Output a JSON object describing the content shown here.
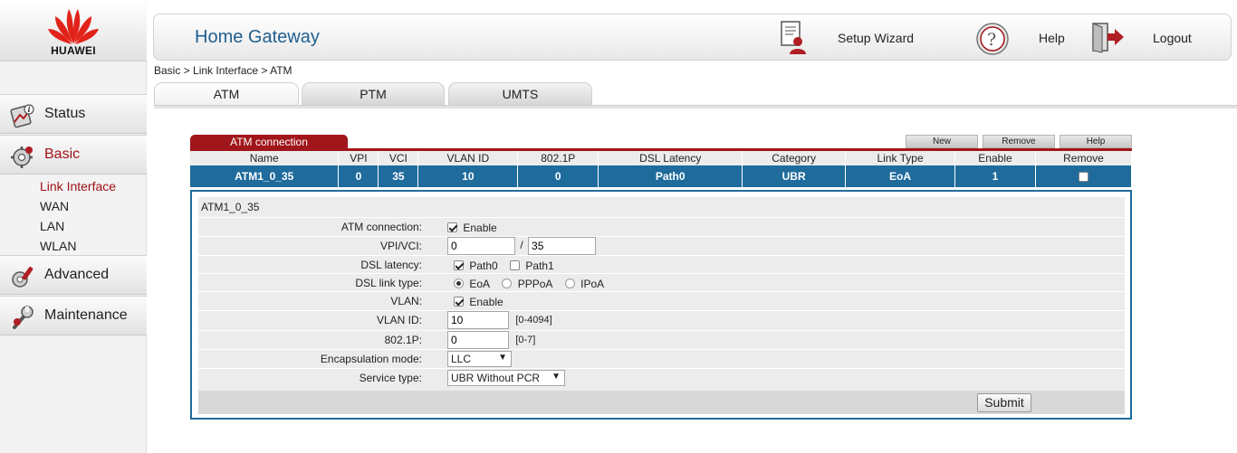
{
  "brand": {
    "name": "HUAWEI",
    "color": "#e2231a"
  },
  "header": {
    "title": "Home Gateway",
    "setup_wizard": "Setup Wizard",
    "help": "Help",
    "logout": "Logout"
  },
  "sidebar": {
    "items": [
      {
        "label": "Status",
        "icon": "status-icon"
      },
      {
        "label": "Basic",
        "icon": "basic-icon",
        "active": true
      },
      {
        "label": "Advanced",
        "icon": "advanced-icon"
      },
      {
        "label": "Maintenance",
        "icon": "maintenance-icon"
      }
    ],
    "basic_sub": [
      "Link Interface",
      "WAN",
      "LAN",
      "WLAN"
    ]
  },
  "breadcrumb": "Basic > Link Interface > ATM",
  "tabs": [
    "ATM",
    "PTM",
    "UMTS"
  ],
  "table": {
    "section_title": "ATM connection",
    "buttons": {
      "new": "New",
      "remove": "Remove",
      "help": "Help"
    },
    "columns": [
      "Name",
      "VPI",
      "VCI",
      "VLAN ID",
      "802.1P",
      "DSL Latency",
      "Category",
      "Link Type",
      "Enable",
      "Remove"
    ],
    "rows": [
      {
        "name": "ATM1_0_35",
        "vpi": "0",
        "vci": "35",
        "vlan_id": "10",
        "p8021": "0",
        "dsl_latency": "Path0",
        "category": "UBR",
        "link_type": "EoA",
        "enable": "1",
        "remove": false
      }
    ]
  },
  "detail": {
    "title": "ATM1_0_35",
    "fields": {
      "atm_connection": {
        "label": "ATM connection:",
        "option": "Enable",
        "checked": true
      },
      "vpi_vci": {
        "label": "VPI/VCI:",
        "vpi": "0",
        "separator": "/",
        "vci": "35"
      },
      "dsl_latency": {
        "label": "DSL latency:",
        "path0": "Path0",
        "path1": "Path1"
      },
      "dsl_link_type": {
        "label": "DSL link type:",
        "eoa": "EoA",
        "pppoa": "PPPoA",
        "ipoa": "IPoA",
        "selected": "EoA"
      },
      "vlan": {
        "label": "VLAN:",
        "option": "Enable",
        "checked": true
      },
      "vlan_id": {
        "label": "VLAN ID:",
        "value": "10",
        "hint": "[0-4094]"
      },
      "p8021": {
        "label": "802.1P:",
        "value": "0",
        "hint": "[0-7]"
      },
      "encapsulation": {
        "label": "Encapsulation mode:",
        "value": "LLC"
      },
      "service_type": {
        "label": "Service type:",
        "value": "UBR Without PCR"
      }
    },
    "submit": "Submit"
  },
  "colors": {
    "accent_red": "#a0161a",
    "table_blue": "#1f6b9c",
    "title_blue": "#1f5f8f"
  }
}
